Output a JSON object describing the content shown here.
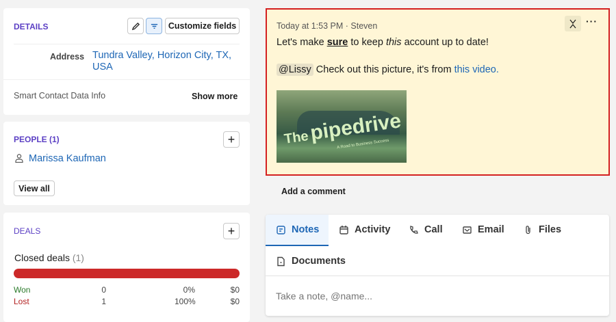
{
  "details": {
    "title": "DETAILS",
    "customize_label": "Customize fields",
    "address_label": "Address",
    "address_value": "Tundra Valley, Horizon City, TX, USA",
    "smart_label": "Smart Contact Data Info",
    "show_more": "Show more"
  },
  "people": {
    "title": "PEOPLE (1)",
    "person": "Marissa Kaufman",
    "view_all": "View all"
  },
  "deals": {
    "title": "DEALS",
    "closed_label": "Closed deals",
    "closed_count": "(1)",
    "bar_color": "#cc2929",
    "lost_fraction": 1.0,
    "rows": [
      {
        "label": "Won",
        "count": "0",
        "pct": "0%",
        "amount": "$0",
        "color": "#2a7a2a"
      },
      {
        "label": "Lost",
        "count": "1",
        "pct": "100%",
        "amount": "$0",
        "color": "#b32020"
      }
    ]
  },
  "note": {
    "meta": "Today at 1:53 PM · Steven",
    "line1_a": "Let's make ",
    "line1_bold": "sure",
    "line1_b": " to keep ",
    "line1_italic": "this",
    "line1_c": " account up to date!",
    "mention": "@Lissy",
    "line2": " Check out this picture, it's from ",
    "link": "this video.",
    "image_title_small": "The",
    "image_title": "pipedrive",
    "image_subtitle": "A Road to Business Success",
    "bg": "#fff6d6",
    "border": "#d42020"
  },
  "add_comment": "Add a comment",
  "tabs": [
    {
      "label": "Notes",
      "icon": "note-icon",
      "active": true
    },
    {
      "label": "Activity",
      "icon": "calendar-icon"
    },
    {
      "label": "Call",
      "icon": "phone-icon"
    },
    {
      "label": "Email",
      "icon": "email-icon"
    },
    {
      "label": "Files",
      "icon": "paperclip-icon"
    },
    {
      "label": "Documents",
      "icon": "document-icon"
    }
  ],
  "note_input": {
    "placeholder": "Take a note, @name..."
  }
}
